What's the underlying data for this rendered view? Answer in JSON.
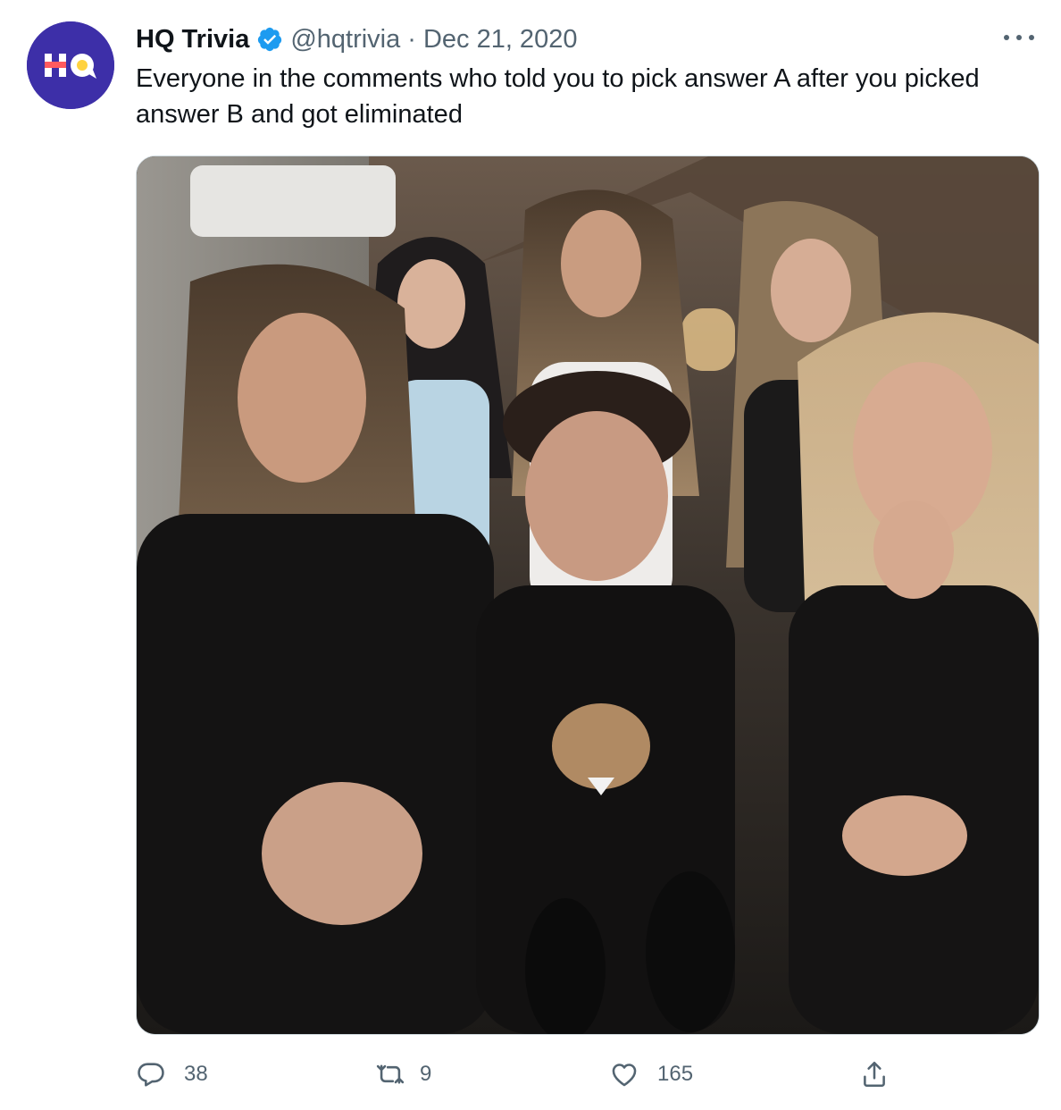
{
  "tweet": {
    "display_name": "HQ Trivia",
    "verified": true,
    "handle": "@hqtrivia",
    "separator": "·",
    "date": "Dec 21, 2020",
    "text": "Everyone in the comments who told you to pick answer A after you picked answer B and got eliminated",
    "avatar": {
      "logo_text": "HQ",
      "background": "#3d2fa8",
      "accent": "#ff5a5f",
      "dot": "#ffd23f"
    },
    "media": {
      "icon": "photo-image"
    }
  },
  "actions": {
    "reply": {
      "icon": "reply-icon",
      "count": "38"
    },
    "retweet": {
      "icon": "retweet-icon",
      "count": "9"
    },
    "like": {
      "icon": "heart-icon",
      "count": "165"
    },
    "share": {
      "icon": "share-icon"
    }
  },
  "colors": {
    "text": "#0f1419",
    "muted": "#536471",
    "verified": "#1d9bf0"
  }
}
